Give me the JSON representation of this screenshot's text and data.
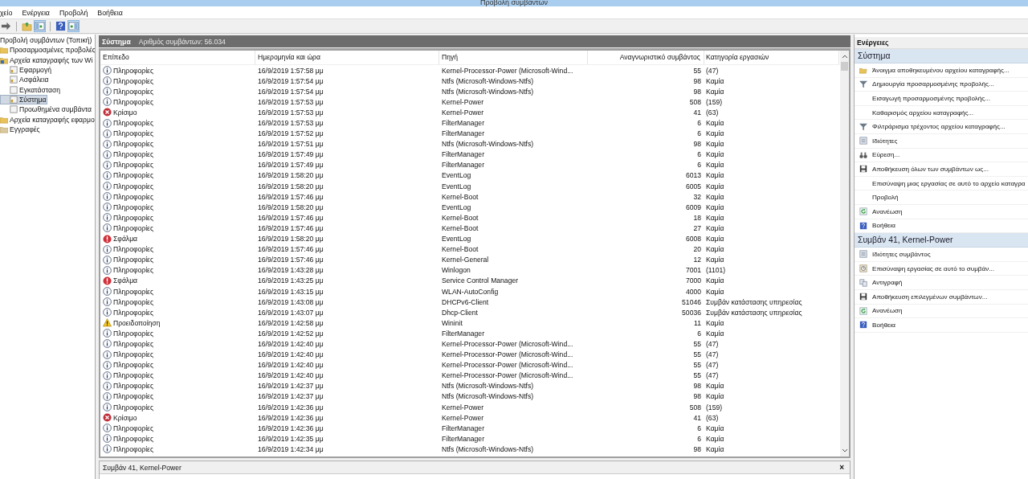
{
  "window": {
    "title": "Προβολή συμβάντων"
  },
  "menu": [
    "χείο",
    "Ενέργεια",
    "Προβολή",
    "Βοήθεια"
  ],
  "tree": [
    {
      "label": "Προβολή συμβάντων (Τοπική)",
      "selected": false,
      "children": [
        {
          "label": "Προσαρμοσμένες προβολές",
          "kind": "folder",
          "selected": false
        },
        {
          "label": "Αρχεία καταγραφής των Wi",
          "kind": "logs",
          "selected": false,
          "children": [
            {
              "label": "Εφαρμογή",
              "kind": "log",
              "selected": false
            },
            {
              "label": "Ασφάλεια",
              "kind": "log",
              "selected": false
            },
            {
              "label": "Εγκατάσταση",
              "kind": "plain",
              "selected": false
            },
            {
              "label": "Σύστημα",
              "kind": "log",
              "selected": true
            },
            {
              "label": "Προωθημένα συμβάντα",
              "kind": "plain",
              "selected": false
            }
          ]
        },
        {
          "label": "Αρχεία καταγραφής εφαρμο",
          "kind": "folder",
          "selected": false
        },
        {
          "label": "Εγγραφές",
          "kind": "subs",
          "selected": false
        }
      ]
    }
  ],
  "log_header": {
    "title": "Σύστημα",
    "count": "Αριθμός συμβάντων: 56.034"
  },
  "table": {
    "columns": [
      "Επίπεδο",
      "Ημερομηνία και ώρα",
      "Πηγή",
      "Αναγνωριστικό συμβάντος",
      "Κατηγορία εργασιών"
    ],
    "rows": [
      {
        "kind": "info",
        "severity": "Πληροφορίες",
        "date": "16/9/2019 1:57:58 μμ",
        "source": "Kernel-Processor-Power (Microsoft-Wind...",
        "event_id": "55",
        "category": "(47)"
      },
      {
        "kind": "info",
        "severity": "Πληροφορίες",
        "date": "16/9/2019 1:57:54 μμ",
        "source": "Ntfs (Microsoft-Windows-Ntfs)",
        "event_id": "98",
        "category": "Καμία"
      },
      {
        "kind": "info",
        "severity": "Πληροφορίες",
        "date": "16/9/2019 1:57:54 μμ",
        "source": "Ntfs (Microsoft-Windows-Ntfs)",
        "event_id": "98",
        "category": "Καμία"
      },
      {
        "kind": "info",
        "severity": "Πληροφορίες",
        "date": "16/9/2019 1:57:53 μμ",
        "source": "Kernel-Power",
        "event_id": "508",
        "category": "(159)"
      },
      {
        "kind": "critical",
        "severity": "Κρίσιμο",
        "date": "16/9/2019 1:57:53 μμ",
        "source": "Kernel-Power",
        "event_id": "41",
        "category": "(63)"
      },
      {
        "kind": "info",
        "severity": "Πληροφορίες",
        "date": "16/9/2019 1:57:53 μμ",
        "source": "FilterManager",
        "event_id": "6",
        "category": "Καμία"
      },
      {
        "kind": "info",
        "severity": "Πληροφορίες",
        "date": "16/9/2019 1:57:52 μμ",
        "source": "FilterManager",
        "event_id": "6",
        "category": "Καμία"
      },
      {
        "kind": "info",
        "severity": "Πληροφορίες",
        "date": "16/9/2019 1:57:51 μμ",
        "source": "Ntfs (Microsoft-Windows-Ntfs)",
        "event_id": "98",
        "category": "Καμία"
      },
      {
        "kind": "info",
        "severity": "Πληροφορίες",
        "date": "16/9/2019 1:57:49 μμ",
        "source": "FilterManager",
        "event_id": "6",
        "category": "Καμία"
      },
      {
        "kind": "info",
        "severity": "Πληροφορίες",
        "date": "16/9/2019 1:57:49 μμ",
        "source": "FilterManager",
        "event_id": "6",
        "category": "Καμία"
      },
      {
        "kind": "info",
        "severity": "Πληροφορίες",
        "date": "16/9/2019 1:58:20 μμ",
        "source": "EventLog",
        "event_id": "6013",
        "category": "Καμία"
      },
      {
        "kind": "info",
        "severity": "Πληροφορίες",
        "date": "16/9/2019 1:58:20 μμ",
        "source": "EventLog",
        "event_id": "6005",
        "category": "Καμία"
      },
      {
        "kind": "info",
        "severity": "Πληροφορίες",
        "date": "16/9/2019 1:57:46 μμ",
        "source": "Kernel-Boot",
        "event_id": "32",
        "category": "Καμία"
      },
      {
        "kind": "info",
        "severity": "Πληροφορίες",
        "date": "16/9/2019 1:58:20 μμ",
        "source": "EventLog",
        "event_id": "6009",
        "category": "Καμία"
      },
      {
        "kind": "info",
        "severity": "Πληροφορίες",
        "date": "16/9/2019 1:57:46 μμ",
        "source": "Kernel-Boot",
        "event_id": "18",
        "category": "Καμία"
      },
      {
        "kind": "info",
        "severity": "Πληροφορίες",
        "date": "16/9/2019 1:57:46 μμ",
        "source": "Kernel-Boot",
        "event_id": "27",
        "category": "Καμία"
      },
      {
        "kind": "error",
        "severity": "Σφάλμα",
        "date": "16/9/2019 1:58:20 μμ",
        "source": "EventLog",
        "event_id": "6008",
        "category": "Καμία"
      },
      {
        "kind": "info",
        "severity": "Πληροφορίες",
        "date": "16/9/2019 1:57:46 μμ",
        "source": "Kernel-Boot",
        "event_id": "20",
        "category": "Καμία"
      },
      {
        "kind": "info",
        "severity": "Πληροφορίες",
        "date": "16/9/2019 1:57:46 μμ",
        "source": "Kernel-General",
        "event_id": "12",
        "category": "Καμία"
      },
      {
        "kind": "info",
        "severity": "Πληροφορίες",
        "date": "16/9/2019 1:43:28 μμ",
        "source": "Winlogon",
        "event_id": "7001",
        "category": "(1101)"
      },
      {
        "kind": "error",
        "severity": "Σφάλμα",
        "date": "16/9/2019 1:43:25 μμ",
        "source": "Service Control Manager",
        "event_id": "7000",
        "category": "Καμία"
      },
      {
        "kind": "info",
        "severity": "Πληροφορίες",
        "date": "16/9/2019 1:43:15 μμ",
        "source": "WLAN-AutoConfig",
        "event_id": "4000",
        "category": "Καμία"
      },
      {
        "kind": "info",
        "severity": "Πληροφορίες",
        "date": "16/9/2019 1:43:08 μμ",
        "source": "DHCPv6-Client",
        "event_id": "51046",
        "category": "Συμβάν κατάστασης υπηρεσίας"
      },
      {
        "kind": "info",
        "severity": "Πληροφορίες",
        "date": "16/9/2019 1:43:07 μμ",
        "source": "Dhcp-Client",
        "event_id": "50036",
        "category": "Συμβάν κατάστασης υπηρεσίας"
      },
      {
        "kind": "warning",
        "severity": "Προειδοποίηση",
        "date": "16/9/2019 1:42:58 μμ",
        "source": "Wininit",
        "event_id": "11",
        "category": "Καμία"
      },
      {
        "kind": "info",
        "severity": "Πληροφορίες",
        "date": "16/9/2019 1:42:52 μμ",
        "source": "FilterManager",
        "event_id": "6",
        "category": "Καμία"
      },
      {
        "kind": "info",
        "severity": "Πληροφορίες",
        "date": "16/9/2019 1:42:40 μμ",
        "source": "Kernel-Processor-Power (Microsoft-Wind...",
        "event_id": "55",
        "category": "(47)"
      },
      {
        "kind": "info",
        "severity": "Πληροφορίες",
        "date": "16/9/2019 1:42:40 μμ",
        "source": "Kernel-Processor-Power (Microsoft-Wind...",
        "event_id": "55",
        "category": "(47)"
      },
      {
        "kind": "info",
        "severity": "Πληροφορίες",
        "date": "16/9/2019 1:42:40 μμ",
        "source": "Kernel-Processor-Power (Microsoft-Wind...",
        "event_id": "55",
        "category": "(47)"
      },
      {
        "kind": "info",
        "severity": "Πληροφορίες",
        "date": "16/9/2019 1:42:40 μμ",
        "source": "Kernel-Processor-Power (Microsoft-Wind...",
        "event_id": "55",
        "category": "(47)"
      },
      {
        "kind": "info",
        "severity": "Πληροφορίες",
        "date": "16/9/2019 1:42:37 μμ",
        "source": "Ntfs (Microsoft-Windows-Ntfs)",
        "event_id": "98",
        "category": "Καμία"
      },
      {
        "kind": "info",
        "severity": "Πληροφορίες",
        "date": "16/9/2019 1:42:37 μμ",
        "source": "Ntfs (Microsoft-Windows-Ntfs)",
        "event_id": "98",
        "category": "Καμία"
      },
      {
        "kind": "info",
        "severity": "Πληροφορίες",
        "date": "16/9/2019 1:42:36 μμ",
        "source": "Kernel-Power",
        "event_id": "508",
        "category": "(159)"
      },
      {
        "kind": "critical",
        "severity": "Κρίσιμο",
        "date": "16/9/2019 1:42:36 μμ",
        "source": "Kernel-Power",
        "event_id": "41",
        "category": "(63)"
      },
      {
        "kind": "info",
        "severity": "Πληροφορίες",
        "date": "16/9/2019 1:42:36 μμ",
        "source": "FilterManager",
        "event_id": "6",
        "category": "Καμία"
      },
      {
        "kind": "info",
        "severity": "Πληροφορίες",
        "date": "16/9/2019 1:42:35 μμ",
        "source": "FilterManager",
        "event_id": "6",
        "category": "Καμία"
      },
      {
        "kind": "info",
        "severity": "Πληροφορίες",
        "date": "16/9/2019 1:42:34 μμ",
        "source": "Ntfs (Microsoft-Windows-Ntfs)",
        "event_id": "98",
        "category": "Καμία"
      }
    ]
  },
  "detail_pane": {
    "title": "Συμβάν 41, Kernel-Power",
    "close": "×"
  },
  "actions": {
    "title": "Ενέργειες",
    "sections": [
      {
        "title": "Σύστημα",
        "items": [
          {
            "label": "Άνοιγμα αποθηκευμένου αρχείου καταγραφής...",
            "kind": "open"
          },
          {
            "label": "Δημιουργία προσαρμοσμένης προβολής...",
            "kind": "filter"
          },
          {
            "label": "Εισαγωγή προσαρμοσμένης προβολής...",
            "kind": "none"
          },
          {
            "label": "Καθαρισμός αρχείου καταγραφής...",
            "kind": "none"
          },
          {
            "label": "Φιλτράρισμα τρέχοντος αρχείου καταγραφής...",
            "kind": "filter"
          },
          {
            "label": "Ιδιότητες",
            "kind": "properties"
          },
          {
            "label": "Εύρεση...",
            "kind": "find"
          },
          {
            "label": "Αποθήκευση όλων των συμβάντων ως...",
            "kind": "save"
          },
          {
            "label": "Επισύναψη μιας εργασίας σε αυτό το αρχείο καταγρα",
            "kind": "none"
          },
          {
            "label": "Προβολή",
            "kind": "none"
          },
          {
            "label": "Ανανέωση",
            "kind": "refresh"
          },
          {
            "label": "Βοήθεια",
            "kind": "help"
          }
        ]
      },
      {
        "title": "Συμβάν 41, Kernel-Power",
        "items": [
          {
            "label": "Ιδιότητες συμβάντος",
            "kind": "properties"
          },
          {
            "label": "Επισύναψη εργασίας σε αυτό το συμβάν...",
            "kind": "task"
          },
          {
            "label": "Αντιγραφή",
            "kind": "copy"
          },
          {
            "label": "Αποθήκευση επιλεγμένων συμβάντων...",
            "kind": "save"
          },
          {
            "label": "Ανανέωση",
            "kind": "refresh"
          },
          {
            "label": "Βοήθεια",
            "kind": "help"
          }
        ]
      }
    ]
  }
}
